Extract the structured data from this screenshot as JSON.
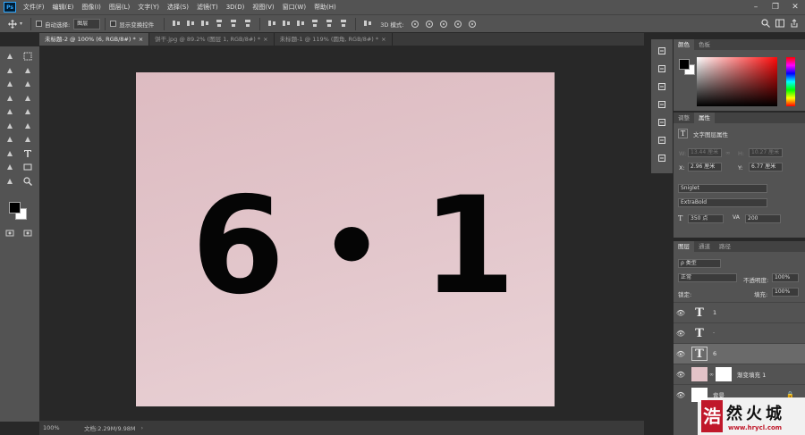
{
  "menubar": {
    "logo": "Ps",
    "items": [
      "文件(F)",
      "编辑(E)",
      "图像(I)",
      "图层(L)",
      "文字(Y)",
      "选择(S)",
      "滤镜(T)",
      "3D(D)",
      "视图(V)",
      "窗口(W)",
      "帮助(H)"
    ]
  },
  "options": {
    "auto_select_label": "自动选择:",
    "auto_select_value": "图层",
    "show_transform_label": "显示变换控件",
    "mode_3d_label": "3D 模式:"
  },
  "tabs": [
    {
      "label": "未标题-2 @ 100% (6, RGB/8#) *",
      "active": true
    },
    {
      "label": "饼干.jpg @ 89.2% (图层 1, RGB/8#) *",
      "active": false
    },
    {
      "label": "未标题-1 @ 119% (圆角, RGB/8#) *",
      "active": false
    }
  ],
  "document": {
    "text_left": "6",
    "text_mid": "•",
    "text_right": "1"
  },
  "status": {
    "zoom": "100%",
    "doc_size": "文档:2.29M/9.98M"
  },
  "color_panel": {
    "tabs": [
      "颜色",
      "色板"
    ],
    "colors": {
      "foreground": "#000000",
      "background": "#ffffff"
    }
  },
  "properties_panel": {
    "tabs": [
      "调整",
      "属性"
    ],
    "title": "文字图层属性",
    "w_label": "W:",
    "w_value": "13.44 厘米",
    "h_label": "H:",
    "h_value": "10.27 厘米",
    "x_label": "X:",
    "x_value": "2.96 厘米",
    "y_label": "Y:",
    "y_value": "6.77 厘米",
    "font_family": "Sniglet",
    "font_style": "ExtraBold",
    "font_size": "350 点",
    "tracking": "200"
  },
  "layers_panel": {
    "tabs": [
      "图层",
      "通道",
      "路径"
    ],
    "filter_label": "ρ 类型",
    "blend_mode": "正常",
    "opacity_label": "不透明度:",
    "opacity_value": "100%",
    "lock_label": "锁定:",
    "fill_label": "填充:",
    "fill_value": "100%",
    "layers": [
      {
        "name": "1",
        "type": "text",
        "selected": false
      },
      {
        "name": "·",
        "type": "text",
        "selected": false
      },
      {
        "name": "6",
        "type": "text",
        "selected": true
      },
      {
        "name": "渐变填充 1",
        "type": "gradient",
        "selected": false
      },
      {
        "name": "背景",
        "type": "background",
        "selected": false
      }
    ]
  },
  "watermark": {
    "text": "然火城",
    "url": "www.hrycl.com",
    "badge": "浩"
  }
}
